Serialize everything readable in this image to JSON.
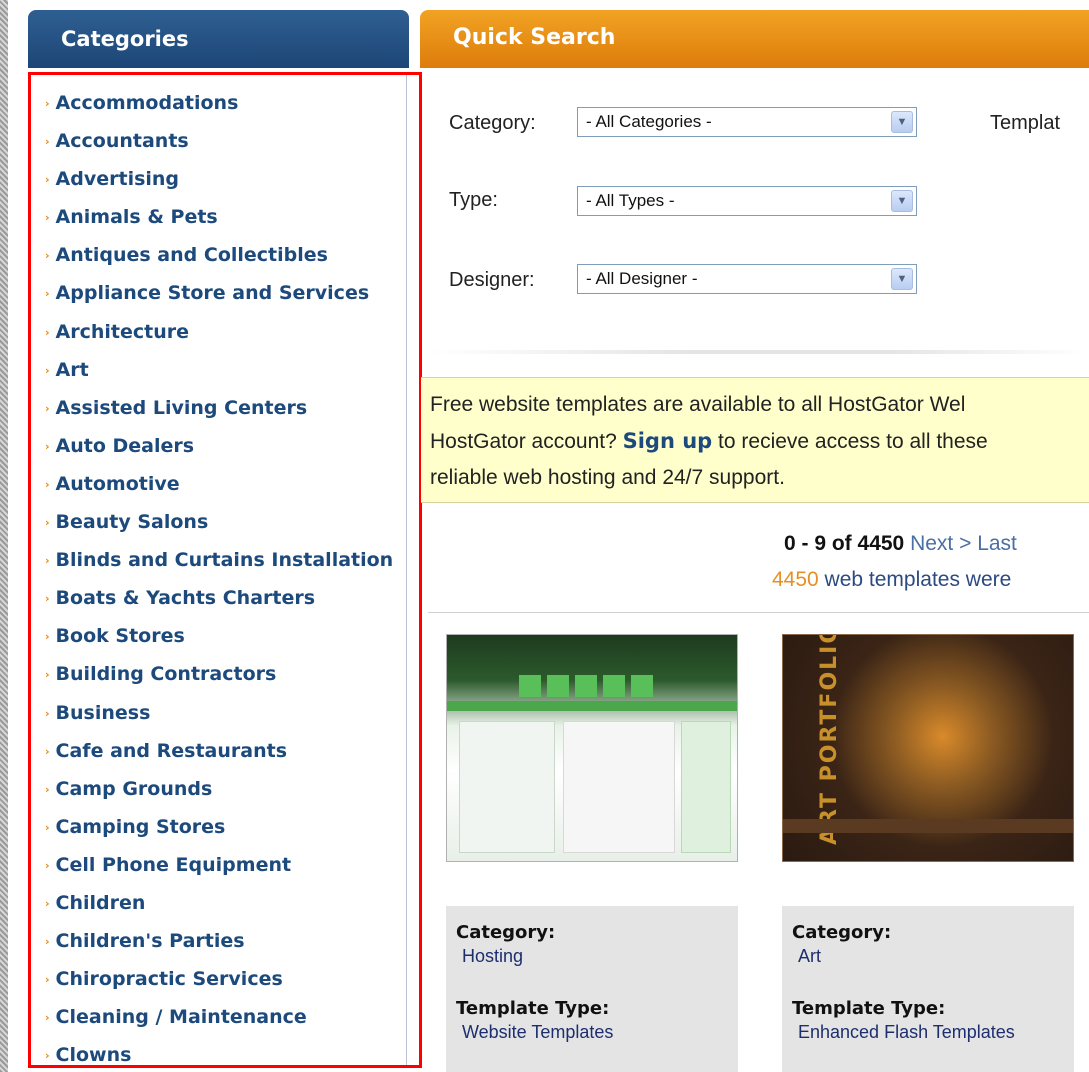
{
  "categories": {
    "title": "Categories",
    "items": [
      "Accommodations",
      "Accountants",
      "Advertising",
      "Animals & Pets",
      "Antiques and Collectibles",
      "Appliance Store and Services",
      "Architecture",
      "Art",
      "Assisted Living Centers",
      "Auto Dealers",
      "Automotive",
      "Beauty Salons",
      "Blinds and Curtains Installation",
      "Boats & Yachts Charters",
      "Book Stores",
      "Building Contractors",
      "Business",
      "Cafe and Restaurants",
      "Camp Grounds",
      "Camping Stores",
      "Cell Phone Equipment",
      "Children",
      "Children's Parties",
      "Chiropractic Services",
      "Cleaning / Maintenance",
      "Clowns"
    ]
  },
  "quick_search": {
    "title": "Quick Search",
    "category_label": "Category:",
    "category_value": "- All Categories -",
    "type_label": "Type:",
    "type_value": "- All Types -",
    "designer_label": "Designer:",
    "designer_value": "- All Designer -",
    "template_label_partial": "Templat"
  },
  "notice": {
    "line1": "Free website templates are available to all HostGator Wel",
    "line2_pre": "HostGator account? ",
    "line2_link": "Sign up",
    "line2_post": " to recieve access to all these",
    "line3": "reliable web hosting and 24/7 support."
  },
  "pager": {
    "range": "0 - 9 of 4450",
    "next": "Next >",
    "last": "Last",
    "count": "4450",
    "count_text": " web templates were "
  },
  "templates": [
    {
      "category_label": "Category:",
      "category": "Hosting",
      "type_label": "Template Type:",
      "type": "Website Templates"
    },
    {
      "category_label": "Category:",
      "category": "Art",
      "type_label": "Template Type:",
      "type": "Enhanced Flash Templates",
      "thumb_text": "ART PORTFOLIO"
    }
  ],
  "colors": {
    "categories_header": "#1c4676",
    "quick_search_header": "#dd7c0c",
    "highlight_border": "#ff0000",
    "notice_bg": "#ffffcc"
  }
}
